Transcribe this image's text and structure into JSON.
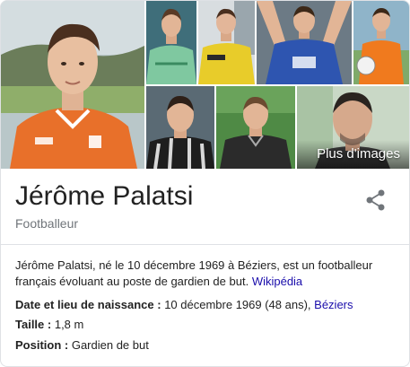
{
  "entity": {
    "name": "Jérôme Palatsi",
    "category": "Footballeur"
  },
  "images": {
    "more_label": "Plus d'images"
  },
  "description": {
    "text": "Jérôme Palatsi, né le 10 décembre 1969 à Béziers, est un footballeur français évoluant au poste de gardien de but.",
    "source_link": "Wikipédia"
  },
  "facts": {
    "birth": {
      "label": "Date et lieu de naissance :",
      "value": "10 décembre 1969 (48 ans),",
      "link": "Béziers"
    },
    "height": {
      "label": "Taille :",
      "value": "1,8 m"
    },
    "position": {
      "label": "Position :",
      "value": "Gardien de but"
    }
  },
  "icons": {
    "share": "share-icon"
  },
  "colors": {
    "link": "#1a0dab",
    "subtle_text": "#70757a",
    "divider": "#dfe1e5",
    "jersey_orange": "#e8702a"
  }
}
